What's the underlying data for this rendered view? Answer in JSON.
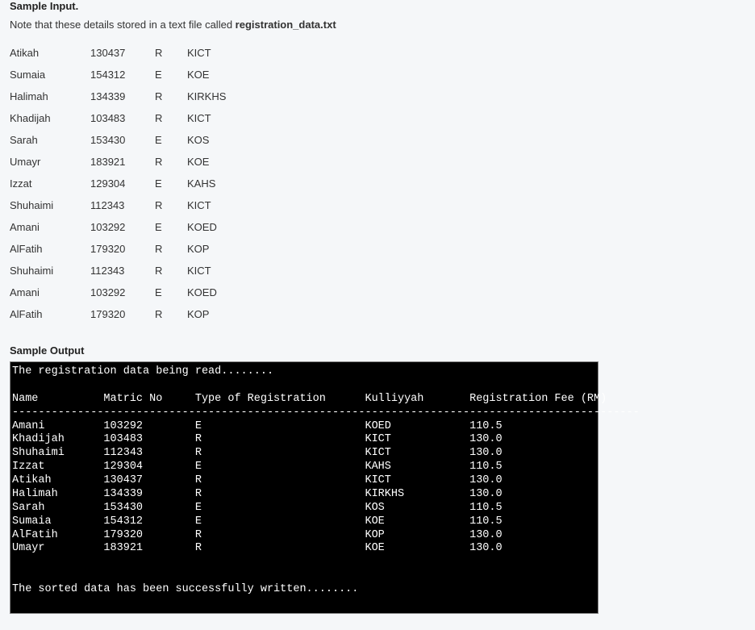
{
  "headings": {
    "sample_input": "Sample Input.",
    "note_prefix": "Note that these details stored in a text file called ",
    "note_bold": "registration_data.txt",
    "sample_output": "Sample Output"
  },
  "input_rows": [
    {
      "name": "Atikah",
      "matric": "130437",
      "type": "R",
      "kull": "KICT"
    },
    {
      "name": "Sumaia",
      "matric": "154312",
      "type": "E",
      "kull": "KOE"
    },
    {
      "name": "Halimah",
      "matric": "134339",
      "type": "R",
      "kull": "KIRKHS"
    },
    {
      "name": "Khadijah",
      "matric": "103483",
      "type": "R",
      "kull": "KICT"
    },
    {
      "name": "Sarah",
      "matric": "153430",
      "type": "E",
      "kull": "KOS"
    },
    {
      "name": "Umayr",
      "matric": "183921",
      "type": "R",
      "kull": "KOE"
    },
    {
      "name": "Izzat",
      "matric": "129304",
      "type": "E",
      "kull": "KAHS"
    },
    {
      "name": "Shuhaimi",
      "matric": "112343",
      "type": "R",
      "kull": "KICT"
    },
    {
      "name": "Amani",
      "matric": "103292",
      "type": "E",
      "kull": "KOED"
    },
    {
      "name": "AlFatih",
      "matric": "179320",
      "type": "R",
      "kull": "KOP"
    },
    {
      "name": "Shuhaimi",
      "matric": "112343",
      "type": "R",
      "kull": "KICT"
    },
    {
      "name": "Amani",
      "matric": "103292",
      "type": "E",
      "kull": "KOED"
    },
    {
      "name": "AlFatih",
      "matric": "179320",
      "type": "R",
      "kull": "KOP"
    }
  ],
  "terminal": {
    "read_line": "The registration data being read........",
    "header": {
      "name": "Name",
      "matric": "Matric No",
      "type": "Type of Registration",
      "kull": "Kulliyyah",
      "fee": "Registration Fee (RM)"
    },
    "dashes": "------------------------------------------------------------------------------------------------",
    "rows": [
      {
        "name": "Amani",
        "matric": "103292",
        "type": "E",
        "kull": "KOED",
        "fee": "110.5"
      },
      {
        "name": "Khadijah",
        "matric": "103483",
        "type": "R",
        "kull": "KICT",
        "fee": "130.0"
      },
      {
        "name": "Shuhaimi",
        "matric": "112343",
        "type": "R",
        "kull": "KICT",
        "fee": "130.0"
      },
      {
        "name": "Izzat",
        "matric": "129304",
        "type": "E",
        "kull": "KAHS",
        "fee": "110.5"
      },
      {
        "name": "Atikah",
        "matric": "130437",
        "type": "R",
        "kull": "KICT",
        "fee": "130.0"
      },
      {
        "name": "Halimah",
        "matric": "134339",
        "type": "R",
        "kull": "KIRKHS",
        "fee": "130.0"
      },
      {
        "name": "Sarah",
        "matric": "153430",
        "type": "E",
        "kull": "KOS",
        "fee": "110.5"
      },
      {
        "name": "Sumaia",
        "matric": "154312",
        "type": "E",
        "kull": "KOE",
        "fee": "110.5"
      },
      {
        "name": "AlFatih",
        "matric": "179320",
        "type": "R",
        "kull": "KOP",
        "fee": "130.0"
      },
      {
        "name": "Umayr",
        "matric": "183921",
        "type": "R",
        "kull": "KOE",
        "fee": "130.0"
      }
    ],
    "success": "The sorted data has been successfully written........"
  }
}
